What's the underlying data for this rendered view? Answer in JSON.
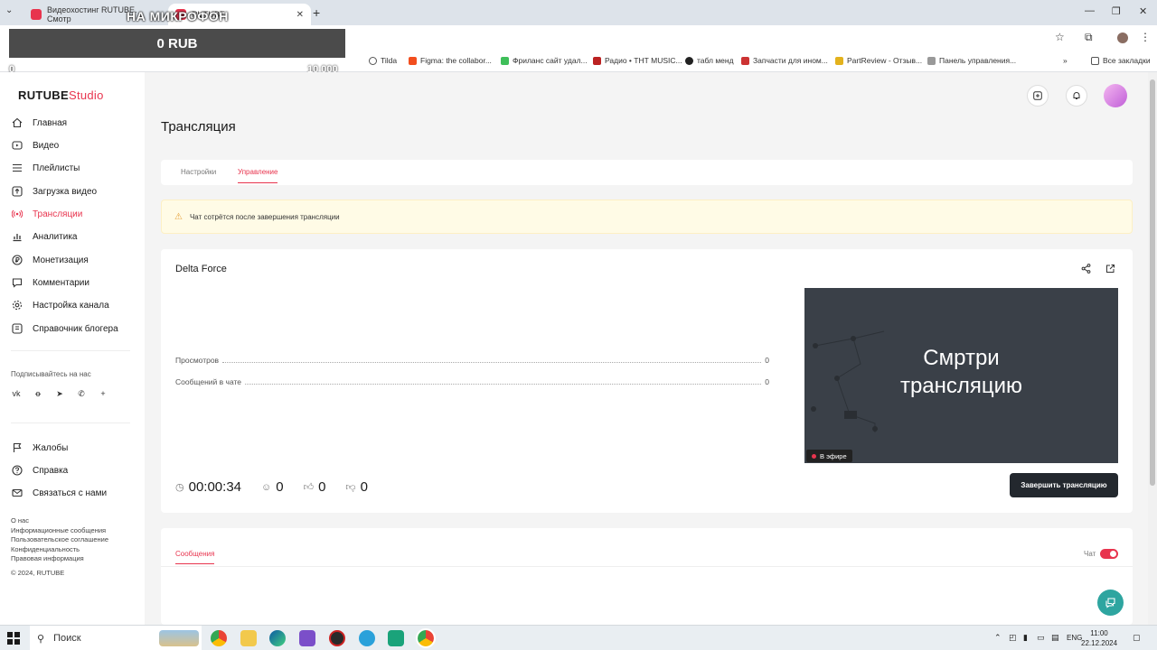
{
  "browser": {
    "tabs": [
      {
        "label": "Видеохостинг RUTUBE. Смотр"
      },
      {
        "label": "RUTUBE"
      }
    ],
    "bookmarks": [
      {
        "label": "Tilda"
      },
      {
        "label": "Figma: the collabor..."
      },
      {
        "label": "Фриланс сайт удал..."
      },
      {
        "label": "Радио • ТНТ MUSIC..."
      },
      {
        "label": "табл менд"
      },
      {
        "label": "Запчасти для ином..."
      },
      {
        "label": "PartReview - Отзыв..."
      },
      {
        "label": "Панель управления..."
      },
      {
        "label": "Все закладки"
      }
    ]
  },
  "overlay": {
    "title": "НА МИКРОФОН",
    "sum": "0 RUB",
    "min": "0",
    "max": "10 000"
  },
  "sidebar": {
    "logo_main": "RUTUBE",
    "logo_studio": "Studio",
    "items": [
      {
        "label": "Главная",
        "icon": "home-icon"
      },
      {
        "label": "Видео",
        "icon": "video-icon"
      },
      {
        "label": "Плейлисты",
        "icon": "playlist-icon"
      },
      {
        "label": "Загрузка видео",
        "icon": "upload-icon"
      },
      {
        "label": "Трансляции",
        "icon": "broadcast-icon",
        "active": true
      },
      {
        "label": "Аналитика",
        "icon": "analytics-icon"
      },
      {
        "label": "Монетизация",
        "icon": "ruble-icon"
      },
      {
        "label": "Комментарии",
        "icon": "comments-icon"
      },
      {
        "label": "Настройка канала",
        "icon": "gear-icon"
      },
      {
        "label": "Справочник блогера",
        "icon": "book-icon"
      }
    ],
    "subscribe_label": "Подписывайтесь на нас",
    "bottom_items": [
      {
        "label": "Жалобы",
        "icon": "flag-icon"
      },
      {
        "label": "Справка",
        "icon": "help-icon"
      },
      {
        "label": "Связаться с нами",
        "icon": "mail-icon"
      }
    ],
    "footer_links": [
      "О нас",
      "Информационные сообщения",
      "Пользовательское соглашение",
      "Конфиденциальность",
      "Правовая информация"
    ],
    "copyright": "© 2024, RUTUBE"
  },
  "main": {
    "page_title": "Трансляция",
    "tabs": [
      {
        "label": "Настройки"
      },
      {
        "label": "Управление",
        "active": true
      }
    ],
    "warning": "Чат сотрётся после завершения трансляции",
    "stream": {
      "name": "Delta Force",
      "stats": [
        {
          "label": "Просмотров",
          "value": "0"
        },
        {
          "label": "Сообщений в чате",
          "value": "0"
        }
      ],
      "preview_text_line1": "Смртри",
      "preview_text_line2": "трансляцию",
      "live_badge": "В эфире",
      "end_button": "Завершить трансляцию",
      "duration": "00:00:34",
      "viewers": "0",
      "likes": "0",
      "dislikes": "0"
    },
    "messages_tab": "Сообщения",
    "chat_label": "Чат",
    "chat_enabled": true
  },
  "taskbar": {
    "search_placeholder": "Поиск",
    "lang": "ENG",
    "time": "11:00",
    "date": "22.12.2024"
  },
  "colors": {
    "accent": "#e8344e",
    "warning_bg": "#fffbe6",
    "preview_bg": "#3a4048",
    "button_dark": "#23282e"
  }
}
